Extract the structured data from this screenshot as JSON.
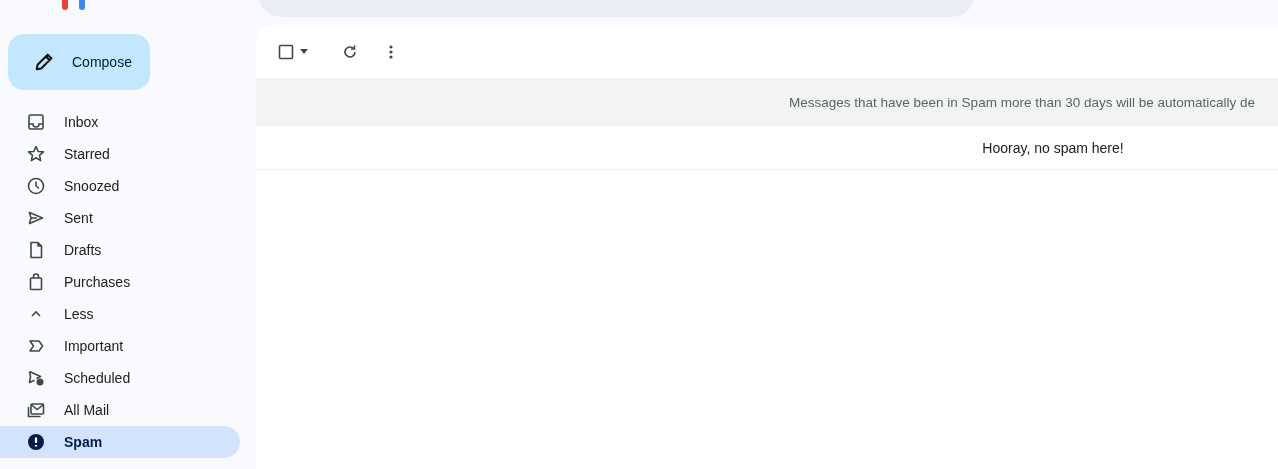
{
  "compose": {
    "label": "Compose"
  },
  "sidebar": {
    "items": [
      {
        "label": "Inbox",
        "kind": "inbox",
        "selected": false
      },
      {
        "label": "Starred",
        "kind": "star",
        "selected": false
      },
      {
        "label": "Snoozed",
        "kind": "clock",
        "selected": false
      },
      {
        "label": "Sent",
        "kind": "send",
        "selected": false
      },
      {
        "label": "Drafts",
        "kind": "file",
        "selected": false
      },
      {
        "label": "Purchases",
        "kind": "bag",
        "selected": false
      },
      {
        "label": "Less",
        "kind": "chevron",
        "selected": false
      },
      {
        "label": "Important",
        "kind": "important",
        "selected": false
      },
      {
        "label": "Scheduled",
        "kind": "scheduled",
        "selected": false
      },
      {
        "label": "All Mail",
        "kind": "allmail",
        "selected": false
      },
      {
        "label": "Spam",
        "kind": "spam",
        "selected": true
      }
    ]
  },
  "toolbar": {
    "select_all": {
      "checked": false
    }
  },
  "banner": {
    "text": "Messages that have been in Spam more than 30 days will be automatically de"
  },
  "empty_message": "Hooray, no spam here!"
}
